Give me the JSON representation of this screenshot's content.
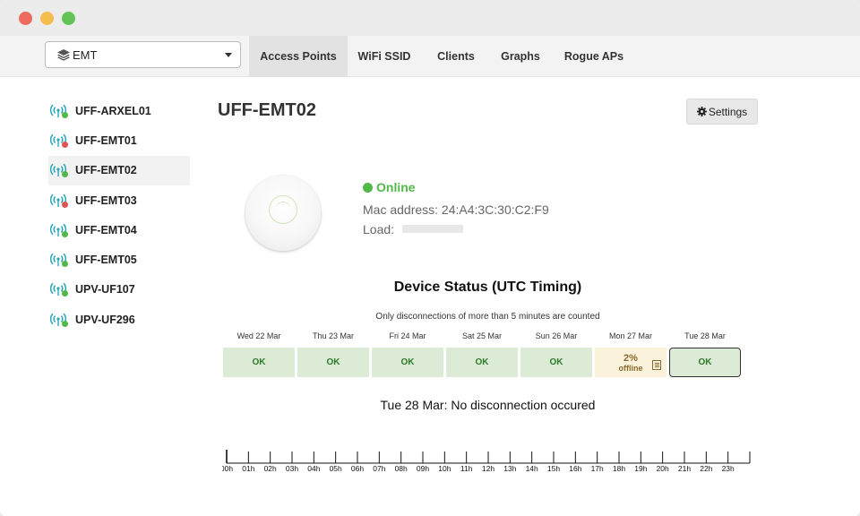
{
  "site_select": {
    "value": "EMT"
  },
  "tabs": [
    {
      "label": "Access Points",
      "active": true
    },
    {
      "label": "WiFi SSID",
      "active": false
    },
    {
      "label": "Clients",
      "active": false
    },
    {
      "label": "Graphs",
      "active": false
    },
    {
      "label": "Rogue APs",
      "active": false
    }
  ],
  "access_points": [
    {
      "name": "UFF-ARXEL01",
      "status": "online",
      "active": false
    },
    {
      "name": "UFF-EMT01",
      "status": "offline",
      "active": false
    },
    {
      "name": "UFF-EMT02",
      "status": "online",
      "active": true
    },
    {
      "name": "UFF-EMT03",
      "status": "offline",
      "active": false
    },
    {
      "name": "UFF-EMT04",
      "status": "online",
      "active": false
    },
    {
      "name": "UFF-EMT05",
      "status": "online",
      "active": false
    },
    {
      "name": "UPV-UF107",
      "status": "online",
      "active": false
    },
    {
      "name": "UPV-UF296",
      "status": "online",
      "active": false
    }
  ],
  "device": {
    "title": "UFF-EMT02",
    "settings_label": "Settings",
    "status": "Online",
    "mac_label": "Mac address: 24:A4:3C:30:C2:F9",
    "load_label": "Load:"
  },
  "device_status": {
    "title": "Device Status (UTC Timing)",
    "subtitle": "Only disconnections of more than 5 minutes are counted",
    "days": [
      {
        "label": "Wed 22 Mar",
        "status": "OK"
      },
      {
        "label": "Thu 23 Mar",
        "status": "OK"
      },
      {
        "label": "Fri 24 Mar",
        "status": "OK"
      },
      {
        "label": "Sat 25 Mar",
        "status": "OK"
      },
      {
        "label": "Sun 26 Mar",
        "status": "OK"
      },
      {
        "label": "Mon 27 Mar",
        "status": "2%",
        "note": "offline"
      },
      {
        "label": "Tue 28 Mar",
        "status": "OK",
        "selected": true
      }
    ],
    "message": "Tue 28 Mar: No disconnection occured"
  },
  "timeline_hours": [
    "00h",
    "01h",
    "02h",
    "03h",
    "04h",
    "05h",
    "06h",
    "07h",
    "08h",
    "09h",
    "10h",
    "11h",
    "12h",
    "13h",
    "14h",
    "15h",
    "16h",
    "17h",
    "18h",
    "19h",
    "20h",
    "21h",
    "22h",
    "23h"
  ],
  "colors": {
    "online": "#52b848",
    "offline": "#e05454",
    "wifi_icon": "#2aa7b7",
    "ok_bg": "#dcebd5",
    "warn_bg": "#fbf2dc"
  },
  "icons": {
    "ap": "wifi-antenna-icon",
    "settings": "gear-icon",
    "site": "layers-icon",
    "dropdown": "chevron-down-icon",
    "offline_note": "list-icon"
  }
}
